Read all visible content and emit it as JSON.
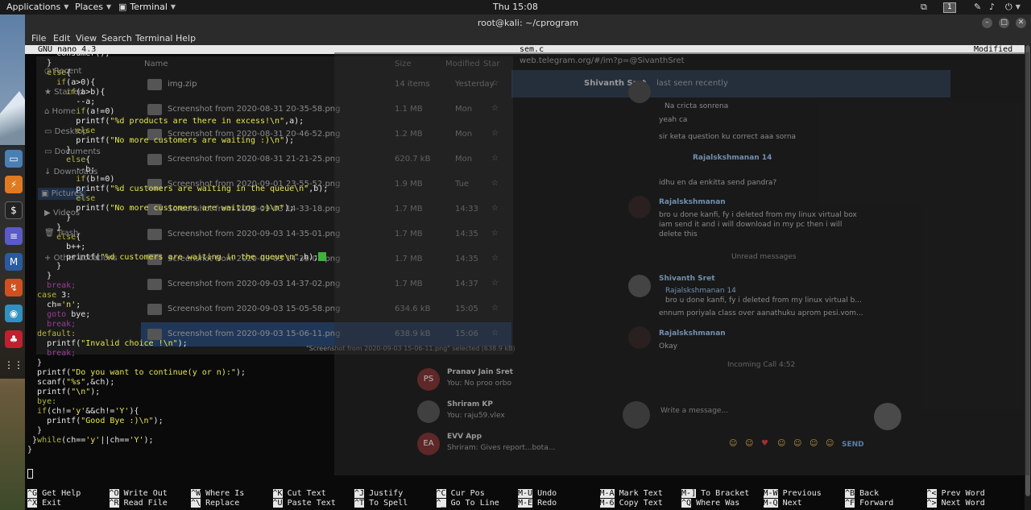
{
  "top_panel": {
    "applications": "Applications",
    "places": "Places",
    "terminal": "Terminal",
    "clock": "Thu 15:08",
    "workspace": "1"
  },
  "terminal": {
    "title": "root@kali: ~/cprogram",
    "menu": [
      "File",
      "Edit",
      "View",
      "Search",
      "Terminal",
      "Help"
    ],
    "nano_version": "GNU nano 4.3",
    "filename": "sem.c",
    "status": "Modified",
    "code_lines": [
      [
        [
          "",
          "      consumer();"
        ]
      ],
      [
        [
          "",
          "    }"
        ]
      ],
      [
        [
          "kw",
          "    else"
        ],
        [
          "",
          "{"
        ]
      ],
      [
        [
          "kw",
          "      if"
        ],
        [
          "",
          "(a>0){"
        ]
      ],
      [
        [
          "kw",
          "        if"
        ],
        [
          "",
          "(a>b){"
        ]
      ],
      [
        [
          "",
          "          --a;"
        ]
      ],
      [
        [
          "kw",
          "          if"
        ],
        [
          "",
          "(a!=0)"
        ]
      ],
      [
        [
          "",
          "          printf("
        ],
        [
          "str",
          "\"%d products are there in excess!\\n\""
        ],
        [
          "",
          ",a);"
        ]
      ],
      [
        [
          "kw",
          "          else"
        ]
      ],
      [
        [
          "",
          "          printf("
        ],
        [
          "str",
          "\"No more customers are waiting :)\\n\""
        ],
        [
          "",
          ");"
        ]
      ],
      [
        [
          "",
          "        }"
        ]
      ],
      [
        [
          "kw",
          "        else"
        ],
        [
          "",
          "{"
        ]
      ],
      [
        [
          "",
          "          --b;"
        ]
      ],
      [
        [
          "kw",
          "          if"
        ],
        [
          "",
          "(b!=0)"
        ]
      ],
      [
        [
          "",
          "          printf("
        ],
        [
          "str",
          "\"%d customers are waiting in the queue\\n\""
        ],
        [
          "",
          ",b);"
        ]
      ],
      [
        [
          "kw",
          "          else"
        ]
      ],
      [
        [
          "",
          "          printf("
        ],
        [
          "str",
          "\"No more customers are waiting :)\\n\""
        ],
        [
          "",
          ");"
        ]
      ],
      [
        [
          "",
          "        }"
        ]
      ],
      [
        [
          "",
          "      }"
        ]
      ],
      [
        [
          "kw",
          "      else"
        ],
        [
          "",
          "{"
        ]
      ],
      [
        [
          "",
          "        b++;"
        ]
      ],
      [
        [
          "",
          "        printf("
        ],
        [
          "str",
          "\"%d customers are waiting in the queue\\n\""
        ],
        [
          "",
          ",b);"
        ],
        [
          "cursor",
          ""
        ]
      ],
      [
        [
          "",
          "      }"
        ]
      ],
      [
        [
          "",
          "    }"
        ]
      ],
      [
        [
          "kw2",
          "    break;"
        ]
      ],
      [
        [
          "kw",
          "  case"
        ],
        [
          "",
          " 3:"
        ]
      ],
      [
        [
          "",
          "    ch="
        ],
        [
          "str",
          "'n'"
        ],
        [
          "",
          ";"
        ]
      ],
      [
        [
          "kw2",
          "    goto"
        ],
        [
          "",
          " bye;"
        ]
      ],
      [
        [
          "kw2",
          "    break;"
        ]
      ],
      [
        [
          "kw",
          "  default:"
        ]
      ],
      [
        [
          "",
          "    printf("
        ],
        [
          "str",
          "\"Invalid choice !\\n\""
        ],
        [
          "",
          ");"
        ]
      ],
      [
        [
          "kw2",
          "    break;"
        ]
      ],
      [
        [
          "",
          "  }"
        ]
      ],
      [
        [
          "",
          "  printf("
        ],
        [
          "str",
          "\"Do you want to continue(y or n):\""
        ],
        [
          "",
          ");"
        ]
      ],
      [
        [
          "",
          "  scanf("
        ],
        [
          "str",
          "\"%s\""
        ],
        [
          "",
          ",&ch);"
        ]
      ],
      [
        [
          "",
          "  printf("
        ],
        [
          "str",
          "\"\\n\""
        ],
        [
          "",
          ");"
        ]
      ],
      [
        [
          "kw",
          "  bye:"
        ]
      ],
      [
        [
          "kw",
          "  if"
        ],
        [
          "",
          "(ch!="
        ],
        [
          "str",
          "'y'"
        ],
        [
          "",
          "&&ch!="
        ],
        [
          "str",
          "'Y'"
        ],
        [
          "",
          "){"
        ]
      ],
      [
        [
          "",
          "    printf("
        ],
        [
          "str",
          "\"Good Bye :)\\n\""
        ],
        [
          "",
          ");"
        ]
      ],
      [
        [
          "",
          "  }"
        ]
      ],
      [
        [
          "",
          " }"
        ],
        [
          "kw",
          "while"
        ],
        [
          "",
          "(ch=="
        ],
        [
          "str",
          "'y'"
        ],
        [
          "",
          "||ch=="
        ],
        [
          "str",
          "'Y'"
        ],
        [
          "",
          ");"
        ]
      ],
      [
        [
          "",
          "}"
        ]
      ]
    ],
    "shortcuts": [
      {
        "key1": "^G",
        "label1": "Get Help",
        "key2": "^X",
        "label2": "Exit"
      },
      {
        "key1": "^O",
        "label1": "Write Out",
        "key2": "^R",
        "label2": "Read File"
      },
      {
        "key1": "^W",
        "label1": "Where Is",
        "key2": "^\\",
        "label2": "Replace"
      },
      {
        "key1": "^K",
        "label1": "Cut Text",
        "key2": "^U",
        "label2": "Paste Text"
      },
      {
        "key1": "^J",
        "label1": "Justify",
        "key2": "^T",
        "label2": "To Spell"
      },
      {
        "key1": "^C",
        "label1": "Cur Pos",
        "key2": "^_",
        "label2": "Go To Line"
      },
      {
        "key1": "M-U",
        "label1": "Undo",
        "key2": "M-E",
        "label2": "Redo"
      },
      {
        "key1": "M-A",
        "label1": "Mark Text",
        "key2": "M-6",
        "label2": "Copy Text"
      },
      {
        "key1": "M-]",
        "label1": "To Bracket",
        "key2": "^Q",
        "label2": "Where Was"
      },
      {
        "key1": "M-W",
        "label1": "Previous",
        "key2": "M-Q",
        "label2": "Next"
      },
      {
        "key1": "^B",
        "label1": "Back",
        "key2": "^F",
        "label2": "Forward"
      },
      {
        "key1": "^<",
        "label1": "Prev Word",
        "key2": "^>",
        "label2": "Next Word"
      }
    ]
  },
  "file_manager": {
    "sidebar": [
      "Recent",
      "Starred",
      "Home",
      "Desktop",
      "Documents",
      "Downloads",
      "Pictures",
      "Videos",
      "Trash",
      "Other Locations"
    ],
    "columns": [
      "Name",
      "Size",
      "Modified",
      "Star"
    ],
    "rows": [
      {
        "name": "img.zip",
        "size": "14 items",
        "modified": "Yesterday"
      },
      {
        "name": "Screenshot from 2020-08-31 20-35-58.png",
        "size": "1.1 MB",
        "modified": "Mon"
      },
      {
        "name": "Screenshot from 2020-08-31 20-46-52.png",
        "size": "1.2 MB",
        "modified": "Mon"
      },
      {
        "name": "Screenshot from 2020-08-31 21-21-25.png",
        "size": "620.7 kB",
        "modified": "Mon"
      },
      {
        "name": "Screenshot from 2020-09-01 23-55-52.png",
        "size": "1.9 MB",
        "modified": "Tue"
      },
      {
        "name": "Screenshot from 2020-09-03 14-33-18.png",
        "size": "1.7 MB",
        "modified": "14:33"
      },
      {
        "name": "Screenshot from 2020-09-03 14-35-01.png",
        "size": "1.7 MB",
        "modified": "14:35"
      },
      {
        "name": "Screenshot from 2020-09-03 14-35-07.png",
        "size": "1.7 MB",
        "modified": "14:35"
      },
      {
        "name": "Screenshot from 2020-09-03 14-37-02.png",
        "size": "1.7 MB",
        "modified": "14:37"
      },
      {
        "name": "Screenshot from 2020-09-03 15-05-58.png",
        "size": "634.6 kB",
        "modified": "15:05"
      },
      {
        "name": "Screenshot from 2020-09-03 15-06-11.png",
        "size": "638.9 kB",
        "modified": "15:06"
      }
    ],
    "status": "\"Screenshot from 2020-09-03 15-06-11.png\" selected (638.9 kB)"
  },
  "telegram": {
    "url": "web.telegram.org/#/im?p=@SivanthSret",
    "header_name": "Shivanth Sret",
    "header_status": "last seen recently",
    "chats": [
      {
        "initials": "PS",
        "name": "Pranav Jain Sret",
        "preview": "You: No proo orbo"
      },
      {
        "initials": "",
        "name": "Shriram KP",
        "preview": "You: raju59.vlex"
      },
      {
        "initials": "EA",
        "name": "EVV App",
        "preview": "Shriram: Gives report...bota..."
      }
    ],
    "messages": [
      {
        "text": "Na cricta sonrena"
      },
      {
        "text": "yeah ca"
      },
      {
        "text": "sir keta question ku correct aaa sorna"
      },
      {
        "text": "Rajalskshmanan 14"
      },
      {
        "text": "idhu en da enkitta send pandra?"
      },
      {
        "text": "Rajalskshmanan"
      },
      {
        "text": "bro u done kanfi, fy i deleted from my linux virtual box"
      },
      {
        "text": "iam send it and i will download in my pc then i will"
      },
      {
        "text": "delete this"
      },
      {
        "text": "Unread messages"
      },
      {
        "text": "Shivanth Sret"
      },
      {
        "text": "Rajalskshmanan 14"
      },
      {
        "text": "bro u done kanfi, fy i deleted from my linux virtual b..."
      },
      {
        "text": "ennum poriyala class over aanathuku aprom pesi.vom..."
      },
      {
        "text": "Rajalskshmanan"
      },
      {
        "text": "Okay"
      },
      {
        "text": "Incoming Call 4:52"
      }
    ],
    "input_placeholder": "Write a message...",
    "send": "SEND"
  }
}
